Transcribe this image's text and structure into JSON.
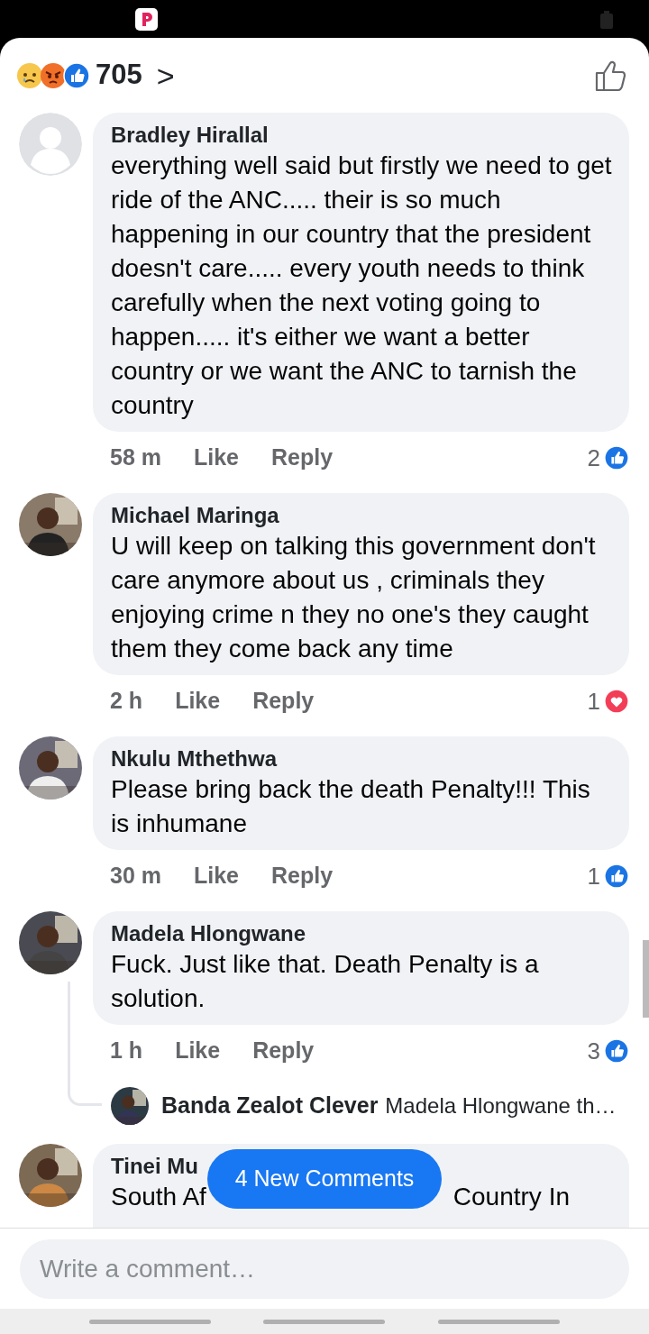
{
  "header": {
    "reactions": [
      {
        "kind": "sad"
      },
      {
        "kind": "angry"
      },
      {
        "kind": "like"
      }
    ],
    "count": "705",
    "arrow": ">"
  },
  "comments": [
    {
      "author": "Bradley Hirallal",
      "avatar": {
        "kind": "default"
      },
      "text": "everything well said but firstly we need to get ride of the ANC..... their is so much happening in our country that the president doesn't care..... every youth needs to think carefully when the next voting going to happen..... it's either we want a better country or we want the ANC to tarnish the country",
      "time": "58 m",
      "like": "Like",
      "reply": "Reply",
      "reaction": {
        "count": "2",
        "kind": "like"
      }
    },
    {
      "author": "Michael Maringa",
      "text": "U will keep on talking this government don't care anymore about  us , criminals they enjoying crime  n they no one's they caught them they come  back any time",
      "time": "2 h",
      "like": "Like",
      "reply": "Reply",
      "reaction": {
        "count": "1",
        "kind": "love"
      }
    },
    {
      "author": "Nkulu Mthethwa",
      "text": "Please bring back the death Penalty!!! This is inhumane",
      "time": "30 m",
      "like": "Like",
      "reply": "Reply",
      "reaction": {
        "count": "1",
        "kind": "like"
      }
    },
    {
      "author": "Madela Hlongwane",
      "text": "Fuck. Just like that. Death Penalty is a solution.",
      "time": "1 h",
      "like": "Like",
      "reply": "Reply",
      "reaction": {
        "count": "3",
        "kind": "like"
      },
      "replies": [
        {
          "author": "Banda Zealot Clever",
          "text": "Madela Hlongwane th…"
        }
      ]
    }
  ],
  "partial_comment": {
    "author": "Tinei Mu",
    "text_start": "South Af",
    "text_end": "Country In"
  },
  "new_comments_button": "4 New Comments",
  "composer": {
    "placeholder": "Write a comment…"
  }
}
